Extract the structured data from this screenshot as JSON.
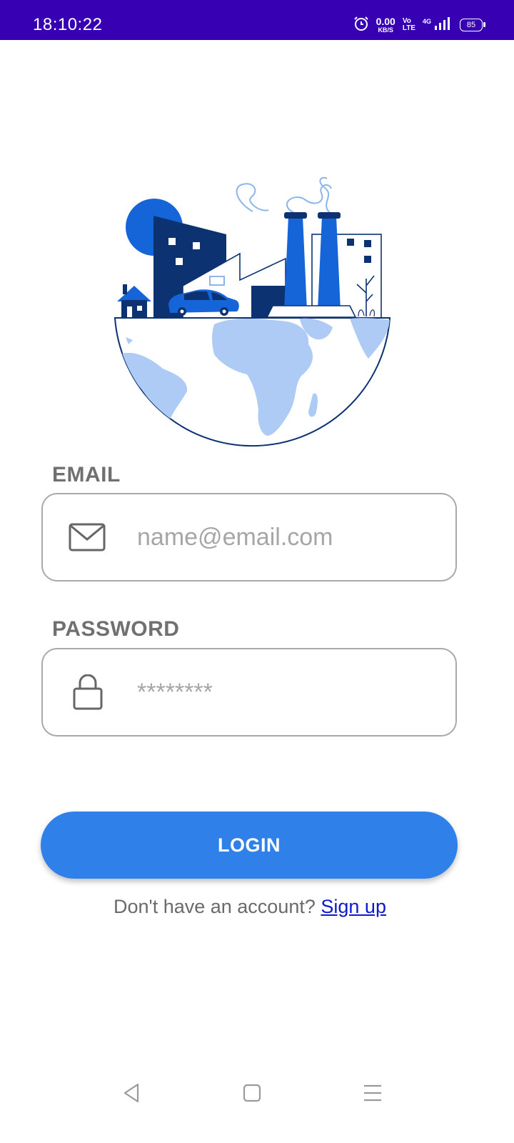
{
  "status_bar": {
    "time": "18:10:22",
    "net_speed_value": "0.00",
    "net_speed_unit": "KB/S",
    "volte_top": "Vo",
    "volte_bottom": "LTE",
    "network": "4G",
    "battery": "85",
    "icons": [
      "alarm-icon",
      "signal-icon",
      "battery-icon"
    ]
  },
  "illustration": {
    "icon": "globe-city-factory-illustration"
  },
  "form": {
    "email_label": "EMAIL",
    "email_placeholder": "name@email.com",
    "email_icon": "envelope-icon",
    "password_label": "PASSWORD",
    "password_placeholder": "********",
    "password_icon": "lock-icon"
  },
  "login_button": "LOGIN",
  "signup": {
    "prompt": "Don't have an account?",
    "link": "Sign up"
  },
  "nav_bar": {
    "icons": [
      "back-icon",
      "home-icon",
      "menu-icon"
    ]
  },
  "colors": {
    "status_bar": "#3700b3",
    "primary_button": "#3080ea",
    "link": "#0d1acb",
    "illustration_dark": "#0d3272",
    "illustration_mid": "#1565d8",
    "illustration_light": "#aecbf5"
  }
}
